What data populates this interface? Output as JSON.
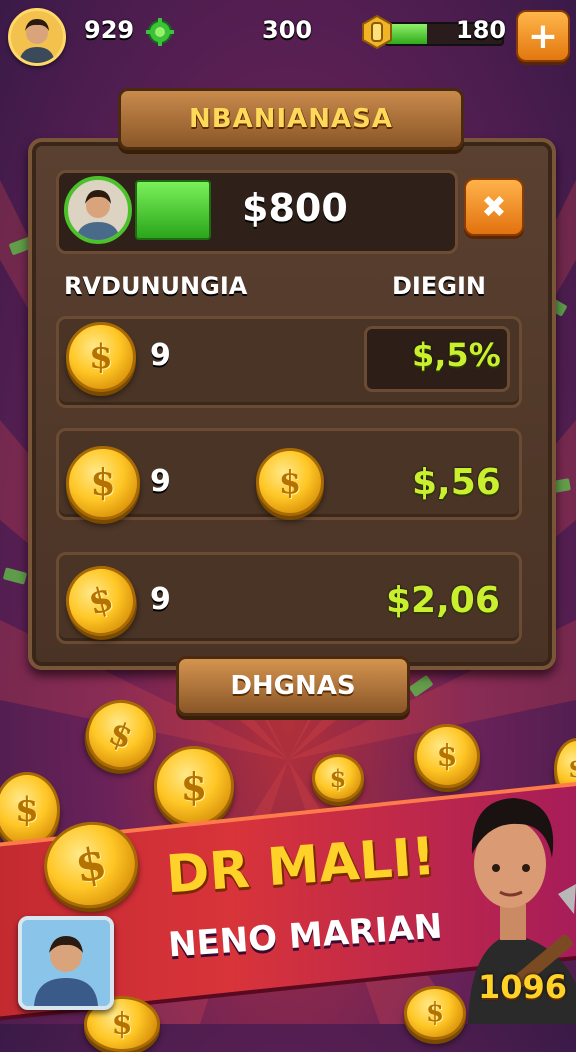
{
  "hud": {
    "coins": "929",
    "gems": "300",
    "energy_value": "180",
    "energy_level": 0.35,
    "plus_label": "+",
    "gem_icon": "gear-gem-icon",
    "energy_icon": "coin-token-icon"
  },
  "panel": {
    "title": "NBANIANASA",
    "player_amount": "$800",
    "close_label": "✖",
    "col_left": "RVDUNUNGIA",
    "col_right": "DIEGIN",
    "rows": [
      {
        "count": "9",
        "value": "$,5%"
      },
      {
        "count": "9",
        "value": "$,56"
      },
      {
        "count": "9",
        "value": "$2,06"
      }
    ],
    "bottom_button": "DHGNAS"
  },
  "banner": {
    "title": "DR MALI!",
    "subtitle": "NENO MARIAN",
    "score": "1096"
  },
  "icons": {
    "coin": "$"
  },
  "colors": {
    "accent_orange": "#e2770f",
    "value_green": "#c9ef2e",
    "banner_red": "#c22a30",
    "title_gold": "#ffd95a"
  }
}
